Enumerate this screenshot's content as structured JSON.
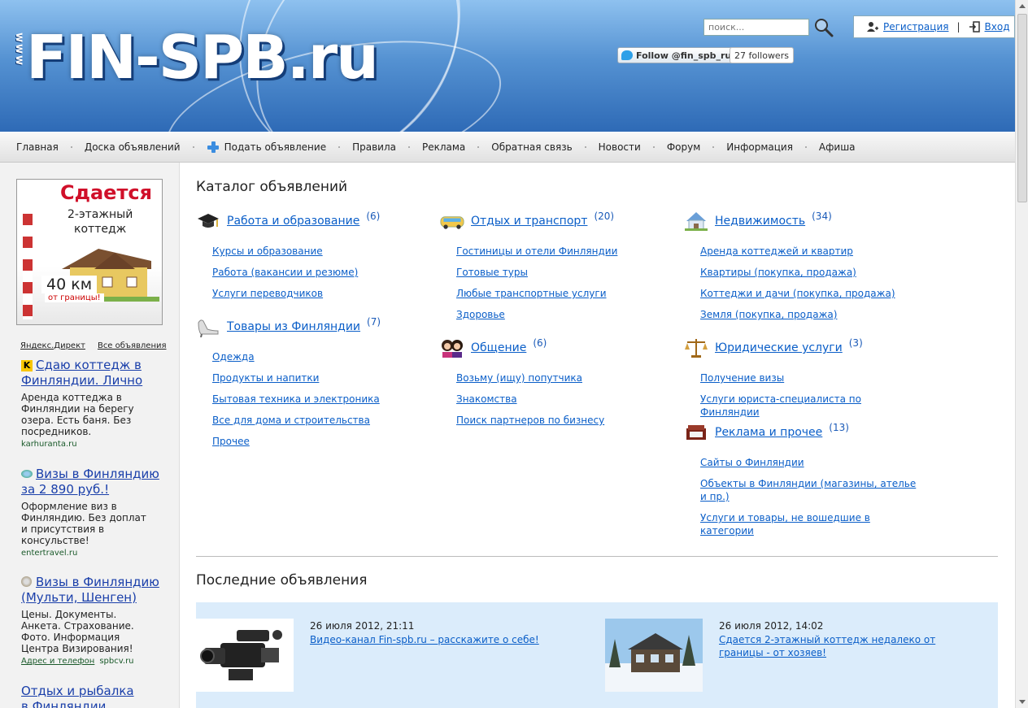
{
  "colors": {
    "header_top": "#8ec1ef",
    "header_bottom": "#2e6ab6",
    "link": "#0a5ec8",
    "latest_bg": "#dbecfb",
    "banner_red": "#d0102a"
  },
  "header": {
    "logo_text": "FIN-SPB.ru",
    "logo_prefix": "www",
    "search_placeholder": "поиск...",
    "twitter_label": "Follow @fin_spb_ru",
    "twitter_followers": "27 followers",
    "register_label": "Регистрация",
    "login_label": "Вход",
    "auth_separator": "|"
  },
  "nav": {
    "items": [
      {
        "label": "Главная"
      },
      {
        "label": "Доска объявлений"
      },
      {
        "label": "Подать объявление"
      },
      {
        "label": "Правила"
      },
      {
        "label": "Реклама"
      },
      {
        "label": "Обратная связь"
      },
      {
        "label": "Новости"
      },
      {
        "label": "Форум"
      },
      {
        "label": "Информация"
      },
      {
        "label": "Афиша"
      }
    ]
  },
  "sidebar": {
    "banner": {
      "title": "Сдается",
      "line1": "2-этажный",
      "line2": "коттедж",
      "distance": "40 км",
      "distance_note": "от границы!"
    },
    "direct_label": "Яндекс.Директ",
    "all_ads_label": "Все объявления",
    "ads": [
      {
        "icon": "k-badge-icon",
        "badge": "K",
        "title": "Сдаю коттедж в Финляндии. Лично",
        "desc": "Аренда коттеджа в Финляндии на берегу озера. Есть баня. Без посредников.",
        "domain": "karhuranta.ru",
        "extra": ""
      },
      {
        "icon": "globe-icon",
        "badge": "",
        "title": "Визы в Финляндию за 2 890 руб.!",
        "desc": "Оформление виз в Финляндию. Без доплат и присутствия в консульстве!",
        "domain": "entertravel.ru",
        "extra": ""
      },
      {
        "icon": "avatar-icon",
        "badge": "",
        "title": "Визы в Финляндию (Мульти, Шенген)",
        "desc": "Цены. Документы. Анкета. Страхование. Фото. Информация Центра Визирования!",
        "domain": "spbcv.ru",
        "extra": "Адрес и телефон"
      },
      {
        "icon": "",
        "badge": "",
        "title": "Отдых и рыбалка в Финляндии",
        "desc": "",
        "domain": "",
        "extra": ""
      }
    ]
  },
  "catalog": {
    "title": "Каталог объявлений",
    "categories": [
      {
        "icon": "graduation-cap-icon",
        "name": "Работа и образование",
        "count": "(6)",
        "subs": [
          "Курсы и образование",
          "Работа (вакансии и резюме)",
          "Услуги переводчиков"
        ]
      },
      {
        "icon": "shoe-icon",
        "name": "Товары из Финляндии",
        "count": "(7)",
        "subs": [
          "Одежда",
          "Продукты и напитки",
          "Бытовая техника и электроника",
          "Все для дома и строительства",
          "Прочее"
        ]
      },
      {
        "icon": "bus-icon",
        "name": "Отдых и транспорт",
        "count": "(20)",
        "subs": [
          "Гостиницы и отели Финляндии",
          "Готовые туры",
          "Любые транспортные услуги",
          "Здоровье"
        ]
      },
      {
        "icon": "people-icon",
        "name": "Общение",
        "count": "(6)",
        "subs": [
          "Возьму (ищу) попутчика",
          "Знакомства",
          "Поиск партнеров по бизнесу"
        ]
      },
      {
        "icon": "house-icon",
        "name": "Недвижимость",
        "count": "(34)",
        "subs": [
          "Аренда коттеджей и квартир",
          "Квартиры (покупка, продажа)",
          "Коттеджи и дачи (покупка, продажа)",
          "Земля (покупка, продажа)"
        ]
      },
      {
        "icon": "scales-icon",
        "name": "Юридические услуги",
        "count": "(3)",
        "subs": [
          "Получение визы",
          "Услуги юриста-специалиста по Финляндии"
        ]
      },
      {
        "icon": "box-icon",
        "name": "Реклама и прочее",
        "count": "(13)",
        "subs": [
          "Сайты о Финляндии",
          "Объекты в Финляндии (магазины, ателье и пр.)",
          "Услуги и товары, не вошедшие в категории"
        ]
      }
    ]
  },
  "latest": {
    "title": "Последние объявления",
    "items": [
      {
        "thumb": "camcorder-thumbnail",
        "date": "26 июля 2012, 21:11",
        "title": "Видео-канал Fin-spb.ru – расскажите о себе!"
      },
      {
        "thumb": "cottage-thumbnail",
        "date": "26 июля 2012, 14:02",
        "title": "Сдается 2-этажный коттедж недалеко от границы - от хозяев!"
      }
    ]
  }
}
